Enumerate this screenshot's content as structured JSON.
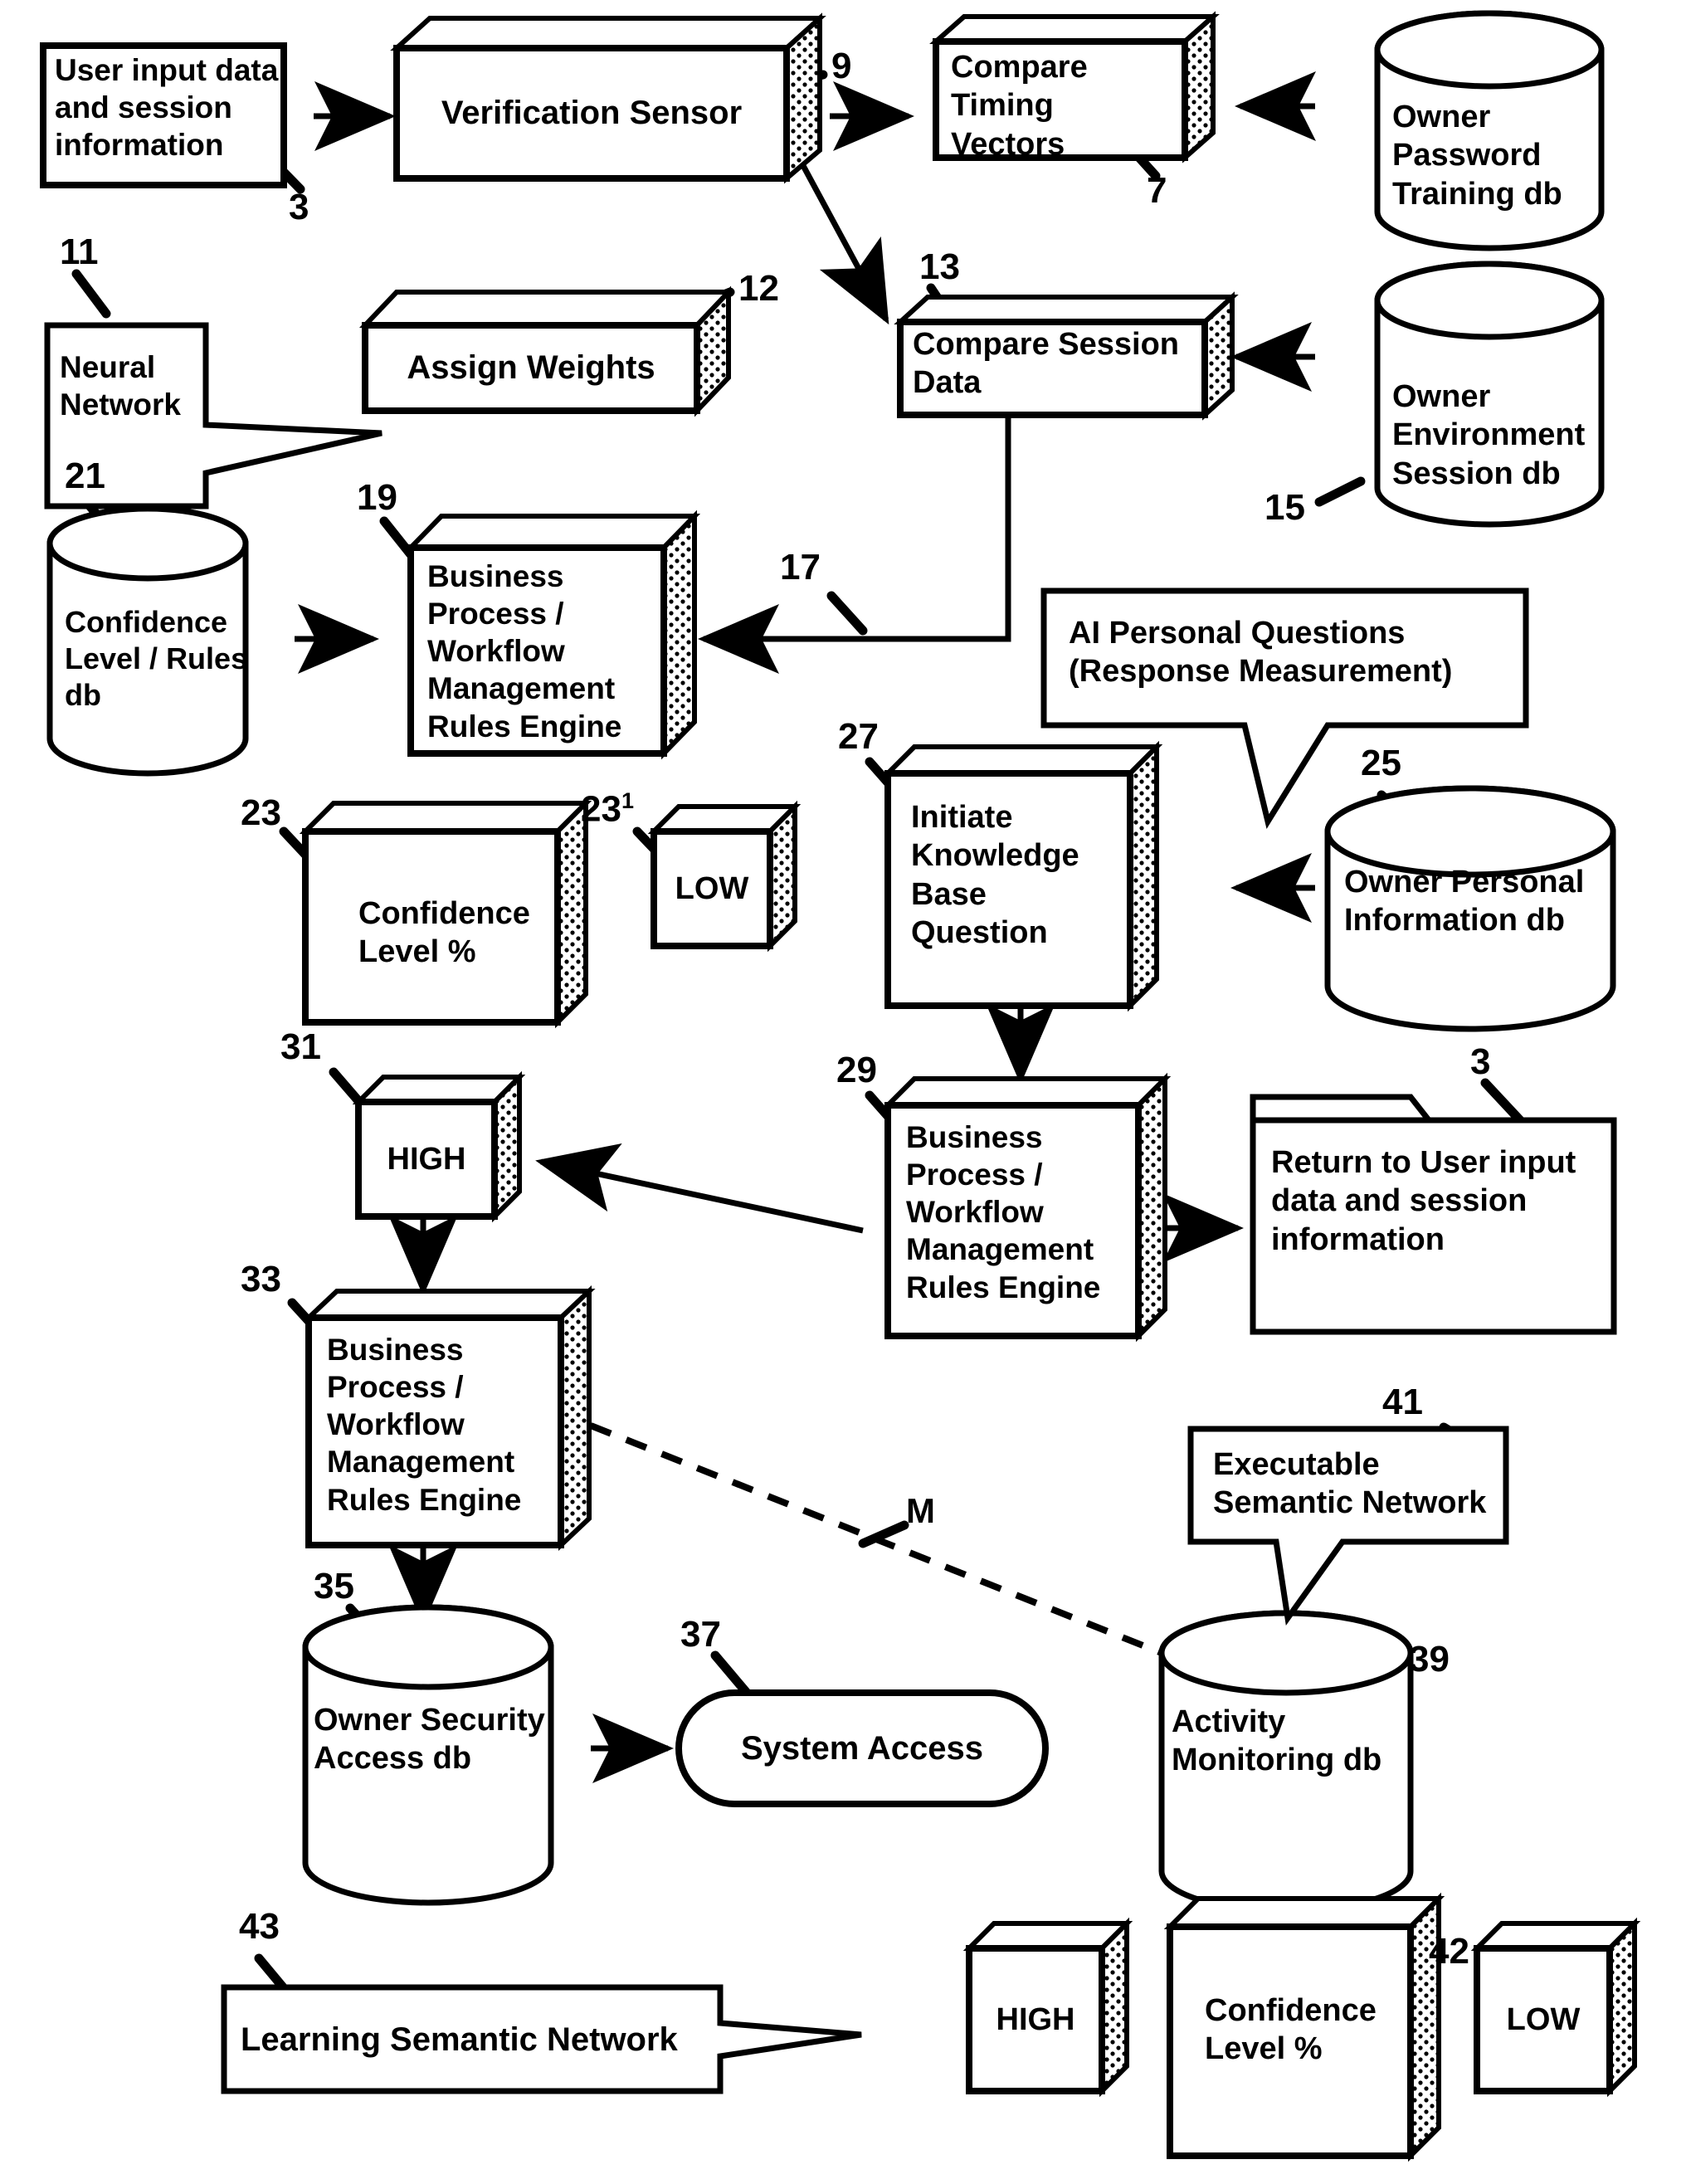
{
  "figure": {
    "domain": "patent-flow-diagram",
    "ink": "#000000",
    "paper": "#ffffff"
  },
  "nodes": {
    "user_input": {
      "label": "User input data and session information",
      "ref": "3",
      "shape": "flat-rectangle"
    },
    "verification_sensor": {
      "label": "Verification Sensor",
      "ref": "9",
      "shape": "box3d"
    },
    "compare_timing": {
      "label": "Compare Timing Vectors",
      "ref": "7",
      "shape": "box3d"
    },
    "owner_password_db": {
      "label": "Owner Password Training db",
      "ref": "",
      "shape": "cylinder"
    },
    "neural_network": {
      "label": "Neural Network",
      "ref": "11",
      "shape": "callout-right"
    },
    "assign_weights": {
      "label": "Assign Weights",
      "ref": "12",
      "shape": "box3d"
    },
    "compare_session": {
      "label": "Compare Session Data",
      "ref": "13",
      "shape": "box3d"
    },
    "owner_env_db": {
      "label": "Owner Environment Session db",
      "ref": "15",
      "shape": "cylinder"
    },
    "confidence_rules_db": {
      "label": "Confidence Level / Rules db",
      "ref": "21",
      "shape": "cylinder"
    },
    "rules_engine_19": {
      "label": "Business Process / Workflow Management Rules Engine",
      "ref": "19",
      "shape": "box3d"
    },
    "ai_personal_questions": {
      "label": "AI Personal Questions (Response Measurement)",
      "ref": "",
      "shape": "callout-down"
    },
    "confidence_level_23": {
      "label": "Confidence Level %",
      "ref": "23",
      "shape": "box3d"
    },
    "low_23_1": {
      "label": "LOW",
      "ref": "23",
      "ref_sup": "1",
      "shape": "box3d"
    },
    "initiate_kb_question": {
      "label": "Initiate Knowledge Base Question",
      "ref": "27",
      "shape": "box3d"
    },
    "owner_personal_db": {
      "label": "Owner Personal Information db",
      "ref": "25",
      "shape": "cylinder"
    },
    "high_31": {
      "label": "HIGH",
      "ref": "31",
      "shape": "box3d"
    },
    "rules_engine_29": {
      "label": "Business Process / Workflow Management Rules Engine",
      "ref": "29",
      "shape": "box3d"
    },
    "return_to_user_input": {
      "label": "Return to User input data and session information",
      "ref": "3",
      "shape": "folder"
    },
    "rules_engine_33": {
      "label": "Business Process / Workflow Management Rules Engine",
      "ref": "33",
      "shape": "box3d"
    },
    "owner_security_db": {
      "label": "Owner Security Access db",
      "ref": "35",
      "shape": "cylinder"
    },
    "system_access": {
      "label": "System Access",
      "ref": "37",
      "shape": "stadium"
    },
    "executable_semantic_network": {
      "label": "Executable Semantic Network",
      "ref": "41",
      "shape": "callout-down"
    },
    "activity_monitoring_db": {
      "label": "Activity Monitoring db",
      "ref": "39",
      "shape": "cylinder"
    },
    "learning_semantic_network": {
      "label": "Learning Semantic Network",
      "ref": "43",
      "shape": "callout-right"
    },
    "high_bottom": {
      "label": "HIGH",
      "ref": "",
      "shape": "box3d"
    },
    "confidence_level_42": {
      "label": "Confidence Level %",
      "ref": "42",
      "shape": "box3d"
    },
    "low_bottom": {
      "label": "LOW",
      "ref": "",
      "shape": "box3d"
    }
  },
  "node_text": {
    "user_input_l1": "User input data",
    "user_input_l2": "and session",
    "user_input_l3": "information",
    "verification_sensor": "Verification Sensor",
    "compare_timing_l1": "Compare Timing",
    "compare_timing_l2": "Vectors",
    "owner_password_l1": "Owner",
    "owner_password_l2": "Password",
    "owner_password_l3": "Training db",
    "neural_network_l1": "Neural",
    "neural_network_l2": "Network",
    "assign_weights": "Assign Weights",
    "compare_session_l1": "Compare Session",
    "compare_session_l2": "Data",
    "owner_env_l1": "Owner",
    "owner_env_l2": "Environment",
    "owner_env_l3": "Session db",
    "conf_rules_l1": "Confidence",
    "conf_rules_l2": "Level / Rules",
    "conf_rules_l3": "db",
    "engine_l1": "Business",
    "engine_l2": "Process /",
    "engine_l3": "Workflow",
    "engine_l4": "Management",
    "engine_l5": "Rules Engine",
    "ai_questions_l1": "AI Personal Questions",
    "ai_questions_l2": "(Response Measurement)",
    "conf_level_l1": "Confidence",
    "conf_level_l2": "Level %",
    "low": "LOW",
    "high": "HIGH",
    "initiate_l1": "Initiate",
    "initiate_l2": "Knowledge",
    "initiate_l3": "Base",
    "initiate_l4": "Question",
    "owner_personal_l1": "Owner Personal",
    "owner_personal_l2": "Information db",
    "return_l1": "Return to User input",
    "return_l2": "data and session",
    "return_l3": "information",
    "owner_security_l1": "Owner Security",
    "owner_security_l2": "Access db",
    "system_access": "System Access",
    "exec_sem_l1": "Executable",
    "exec_sem_l2": "Semantic Network",
    "activity_l1": "Activity",
    "activity_l2": "Monitoring db",
    "learning_sem": "Learning Semantic Network"
  },
  "reference_numerals": {
    "r3_input": "3",
    "r9": "9",
    "r7": "7",
    "r11": "11",
    "r12": "12",
    "r13": "13",
    "r15": "15",
    "r17": "17",
    "r19": "19",
    "r21": "21",
    "r23": "23",
    "r23_prime": "23",
    "r23_prime_sup": "1",
    "r25": "25",
    "r27": "27",
    "r29": "29",
    "r31": "31",
    "r33": "33",
    "r35": "35",
    "r37": "37",
    "r39": "39",
    "r41": "41",
    "r42": "42",
    "r43": "43",
    "r3_return": "3",
    "rM": "M"
  }
}
